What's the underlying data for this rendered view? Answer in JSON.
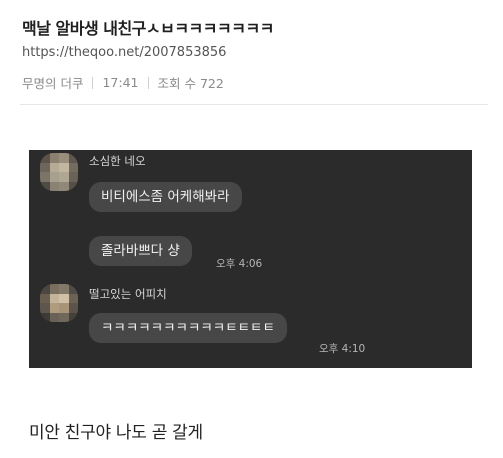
{
  "post": {
    "title": "맥날 알바생 내친구ㅅㅂㅋㅋㅋㅋㅋㅋㅋ",
    "url": "https://theqoo.net/2007853856",
    "author": "무명의 더쿠",
    "time": "17:41",
    "views_label": "조회 수 722"
  },
  "chat": {
    "messages": [
      {
        "sender": "소심한 네오",
        "bubbles": [
          "비티에스좀 어케해봐라",
          "졸라바쁘다 샹"
        ],
        "time": "오후 4:06"
      },
      {
        "sender": "떨고있는 어피치",
        "bubbles": [
          "ㅋㅋㅋㅋㅋㅋㅋㅋㅋㅋㅌㅌㅌㅌ"
        ],
        "time": "오후 4:10"
      }
    ]
  },
  "caption": "미안 친구야 나도 곧 갈게",
  "colors": {
    "chat_background": "#2b2b2b",
    "bubble": "#474747"
  }
}
